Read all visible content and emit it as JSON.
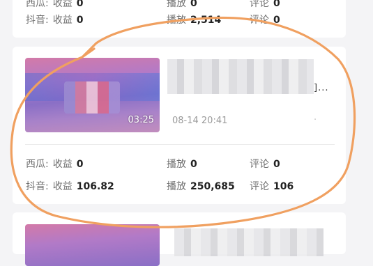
{
  "card_top": {
    "rows": [
      {
        "platform": "西瓜:",
        "income_label": "收益",
        "income": "0",
        "play_label": "播放",
        "play": "0",
        "comment_label": "评论",
        "comment": "0"
      },
      {
        "platform": "抖音:",
        "income_label": "收益",
        "income": "0",
        "play_label": "播放",
        "play": "2,514",
        "comment_label": "评论",
        "comment": "0"
      }
    ]
  },
  "card_main": {
    "duration": "03:25",
    "title_tail": "]...",
    "timestamp": "08-14 20:41",
    "more": "·",
    "rows": [
      {
        "platform": "西瓜:",
        "income_label": "收益",
        "income": "0",
        "play_label": "播放",
        "play": "0",
        "comment_label": "评论",
        "comment": "0"
      },
      {
        "platform": "抖音:",
        "income_label": "收益",
        "income": "106.82",
        "play_label": "播放",
        "play": "250,685",
        "comment_label": "评论",
        "comment": "106"
      }
    ]
  },
  "annotation": {
    "color": "#f0a060"
  }
}
